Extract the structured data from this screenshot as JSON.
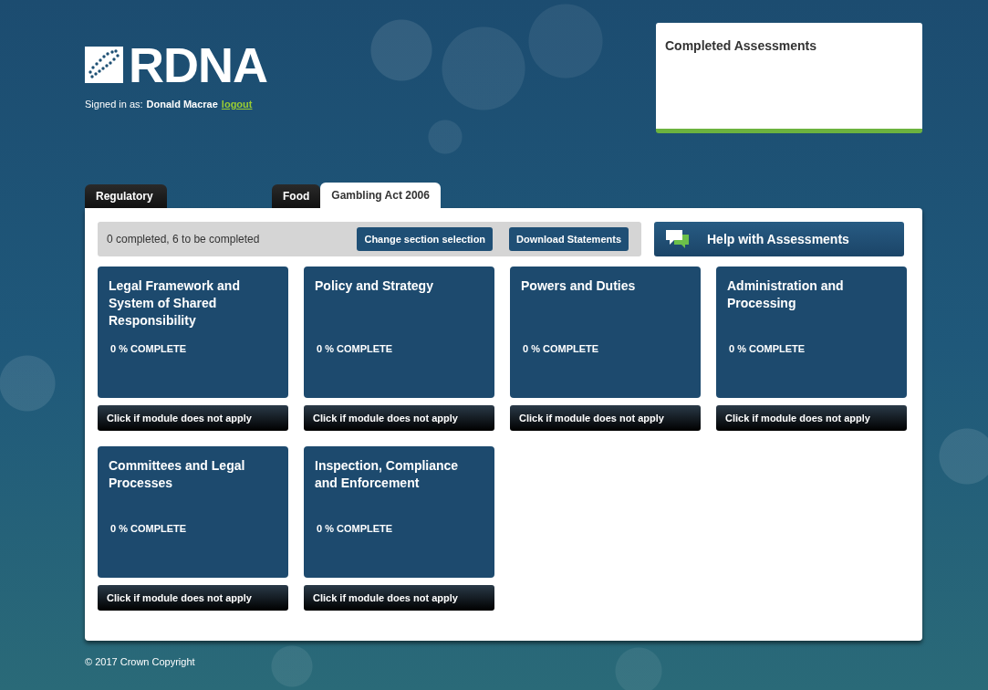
{
  "header": {
    "logo_text": "RDNA",
    "signed_in_label": "Signed in as:",
    "user_name": "Donald Macrae",
    "logout_link": "logout"
  },
  "completed_assessments": {
    "title": "Completed Assessments"
  },
  "tabs": [
    {
      "label": "Regulatory",
      "selected": false
    },
    {
      "label": "Food",
      "selected": false
    },
    {
      "label": "Gambling Act 2006",
      "selected": true
    }
  ],
  "summary": {
    "text": "0 completed, 6 to be completed",
    "buttons": [
      "Change section selection",
      "Download Statements"
    ]
  },
  "help_button": "Help with Assessments",
  "modules": [
    {
      "title": "Legal Framework and System of Shared Responsibility",
      "progress": "0 % COMPLETE",
      "action": "Click if module does not apply"
    },
    {
      "title": "Policy and Strategy",
      "progress": "0 % COMPLETE",
      "action": "Click if module does not apply"
    },
    {
      "title": "Powers and Duties",
      "progress": "0 % COMPLETE",
      "action": "Click if module does not apply"
    },
    {
      "title": "Administration and Processing",
      "progress": "0 % COMPLETE",
      "action": "Click if module does not apply"
    },
    {
      "title": "Committees and Legal Processes",
      "progress": "0 % COMPLETE",
      "action": "Click if module does not apply"
    },
    {
      "title": "Inspection, Compliance and Enforcement",
      "progress": "0 % COMPLETE",
      "action": "Click if module does not apply"
    }
  ],
  "footer": "© 2017 Crown Copyright"
}
